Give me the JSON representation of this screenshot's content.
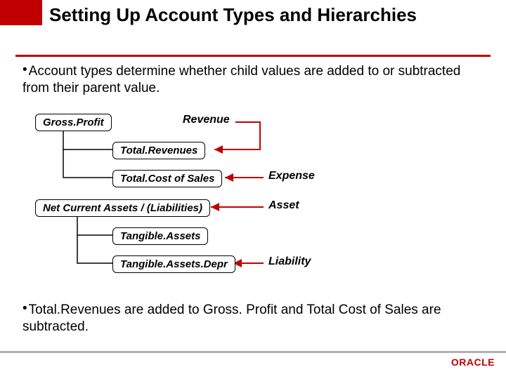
{
  "title": "Setting Up Account Types and Hierarchies",
  "bullets": {
    "b1": "Account types determine whether child values are added to or subtracted from their parent value.",
    "b2": "Total.Revenues are added to Gross. Profit and Total Cost of Sales are subtracted."
  },
  "boxes": {
    "grossProfit": "Gross.Profit",
    "totalRevenues": "Total.Revenues",
    "totalCostOfSales": "Total.Cost of Sales",
    "netCurrentAssets": "Net Current Assets / (Liabilities)",
    "tangibleAssets": "Tangible.Assets",
    "tangibleAssetsDepr": "Tangible.Assets.Depr"
  },
  "labels": {
    "revenue": "Revenue",
    "expense": "Expense",
    "asset": "Asset",
    "liability": "Liability"
  },
  "logo": "ORACLE"
}
